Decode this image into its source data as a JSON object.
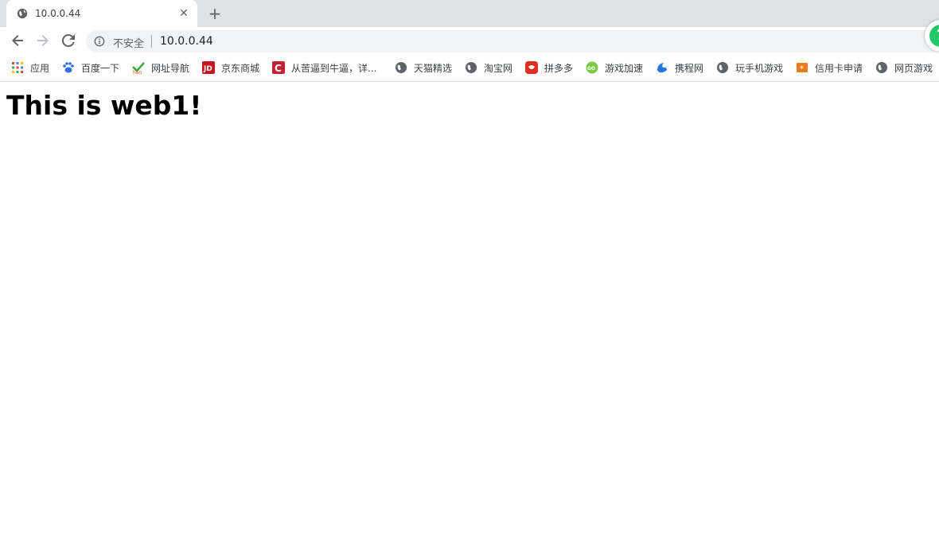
{
  "tab": {
    "title": "10.0.0.44",
    "close_glyph": "✕"
  },
  "newtab_glyph": "+",
  "toolbar": {
    "security_label": "不安全",
    "url": "10.0.0.44"
  },
  "bookmarks": [
    {
      "label": "应用",
      "icon": "apps-grid-icon"
    },
    {
      "label": "百度一下",
      "icon": "baidu-paw-icon"
    },
    {
      "label": "网址导航",
      "icon": "hao123-icon"
    },
    {
      "label": "京东商城",
      "icon": "jd-icon"
    },
    {
      "label": "从苦逼到牛逼，详...",
      "icon": "csdn-icon"
    },
    {
      "label": "天猫精选",
      "icon": "globe-icon"
    },
    {
      "label": "淘宝网",
      "icon": "globe-icon"
    },
    {
      "label": "拼多多",
      "icon": "pinduoduo-icon"
    },
    {
      "label": "游戏加速",
      "icon": "game-boost-icon"
    },
    {
      "label": "携程网",
      "icon": "ctrip-icon"
    },
    {
      "label": "玩手机游戏",
      "icon": "globe-icon"
    },
    {
      "label": "信用卡申请",
      "icon": "credit-card-icon"
    },
    {
      "label": "网页游戏",
      "icon": "globe-icon"
    }
  ],
  "page": {
    "heading": "This is web1!"
  },
  "colors": {
    "tabstrip_bg": "#dee1e6",
    "omnibox_bg": "#f1f3f4",
    "extension_green": "#25c76b"
  }
}
